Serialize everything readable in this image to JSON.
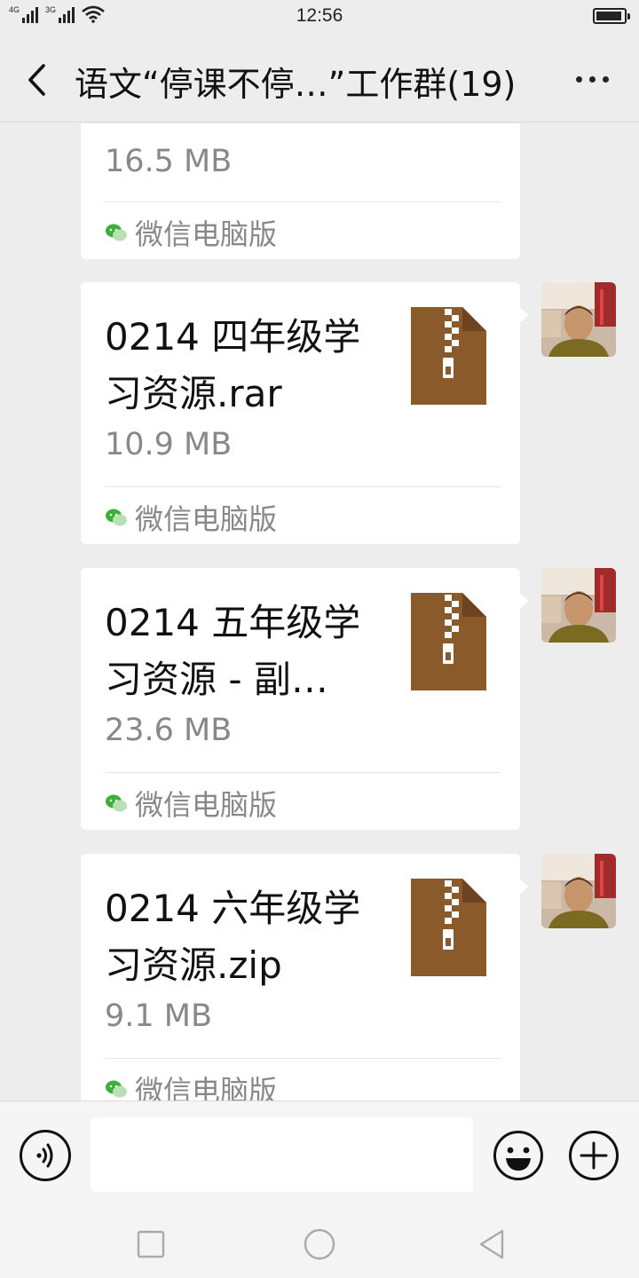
{
  "status_bar": {
    "time": "12:56",
    "network_1": "4G",
    "network_2": "3G",
    "icons": [
      "signal-icon",
      "signal-icon",
      "wifi-icon",
      "battery-icon"
    ]
  },
  "nav": {
    "title": "语文“停课不停…”工作群(19)",
    "back_icon": "chevron-left-icon",
    "more_icon": "more-dots-icon"
  },
  "messages": [
    {
      "file_name": "",
      "file_size": "16.5 MB",
      "source": "微信电脑版",
      "partial": true
    },
    {
      "file_name": "0214 四年级学习资源.rar",
      "file_size": "10.9 MB",
      "source": "微信电脑版"
    },
    {
      "file_name": "0214 五年级学习资源 - 副…",
      "file_size": "23.6 MB",
      "source": "微信电脑版"
    },
    {
      "file_name": "0214 六年级学习资源.zip",
      "file_size": "9.1 MB",
      "source": "微信电脑版"
    }
  ],
  "input_bar": {
    "voice_icon": "voice-icon",
    "input_value": "",
    "emoji_icon": "emoji-icon",
    "plus_icon": "plus-circle-icon"
  },
  "system_nav": [
    "recent-apps-icon",
    "home-icon",
    "back-triangle-icon"
  ],
  "colors": {
    "background": "#ededed",
    "bubble": "#ffffff",
    "archive_icon": "#8b5a2b",
    "secondary_text": "#888888",
    "wechat_green": "#3cb034"
  }
}
